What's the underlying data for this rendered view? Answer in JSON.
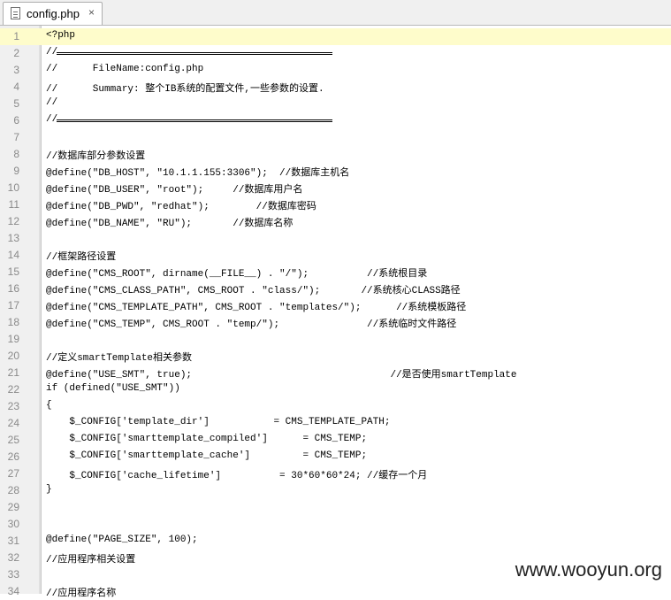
{
  "tab": {
    "filename": "config.php",
    "close": "×"
  },
  "lines": [
    {
      "n": "1",
      "text": "<?php"
    },
    {
      "n": "2",
      "text": "//",
      "sep": true
    },
    {
      "n": "3",
      "text": "//      FileName:config.php"
    },
    {
      "n": "4",
      "text": "//      Summary: 整个IB系统的配置文件,一些参数的设置."
    },
    {
      "n": "5",
      "text": "//"
    },
    {
      "n": "6",
      "text": "//",
      "sep": true
    },
    {
      "n": "7",
      "text": ""
    },
    {
      "n": "8",
      "text": "//数据库部分参数设置"
    },
    {
      "n": "9",
      "text": "@define(\"DB_HOST\", \"10.1.1.155:3306\");  //数据库主机名"
    },
    {
      "n": "10",
      "text": "@define(\"DB_USER\", \"root\");     //数据库用户名"
    },
    {
      "n": "11",
      "text": "@define(\"DB_PWD\", \"redhat\");        //数据库密码"
    },
    {
      "n": "12",
      "text": "@define(\"DB_NAME\", \"RU\");       //数据库名称"
    },
    {
      "n": "13",
      "text": ""
    },
    {
      "n": "14",
      "text": "//框架路径设置"
    },
    {
      "n": "15",
      "text": "@define(\"CMS_ROOT\", dirname(__FILE__) . \"/\");          //系统根目录"
    },
    {
      "n": "16",
      "text": "@define(\"CMS_CLASS_PATH\", CMS_ROOT . \"class/\");       //系统核心CLASS路径"
    },
    {
      "n": "17",
      "text": "@define(\"CMS_TEMPLATE_PATH\", CMS_ROOT . \"templates/\");      //系统模板路径"
    },
    {
      "n": "18",
      "text": "@define(\"CMS_TEMP\", CMS_ROOT . \"temp/\");               //系统临时文件路径"
    },
    {
      "n": "19",
      "text": ""
    },
    {
      "n": "20",
      "text": "//定义smartTemplate相关参数"
    },
    {
      "n": "21",
      "text": "@define(\"USE_SMT\", true);                                  //是否使用smartTemplate"
    },
    {
      "n": "22",
      "text": "if (defined(\"USE_SMT\"))"
    },
    {
      "n": "23",
      "text": "{"
    },
    {
      "n": "24",
      "text": "    $_CONFIG['template_dir']           = CMS_TEMPLATE_PATH;"
    },
    {
      "n": "25",
      "text": "    $_CONFIG['smarttemplate_compiled']      = CMS_TEMP;"
    },
    {
      "n": "26",
      "text": "    $_CONFIG['smarttemplate_cache']         = CMS_TEMP;"
    },
    {
      "n": "27",
      "text": "    $_CONFIG['cache_lifetime']          = 30*60*60*24; //缓存一个月"
    },
    {
      "n": "28",
      "text": "}"
    },
    {
      "n": "29",
      "text": ""
    },
    {
      "n": "30",
      "text": ""
    },
    {
      "n": "31",
      "text": "@define(\"PAGE_SIZE\", 100);"
    },
    {
      "n": "32",
      "text": "//应用程序相关设置"
    },
    {
      "n": "33",
      "text": ""
    },
    {
      "n": "34",
      "text": "//应用程序名称"
    }
  ],
  "watermark": "www.wooyun.org"
}
